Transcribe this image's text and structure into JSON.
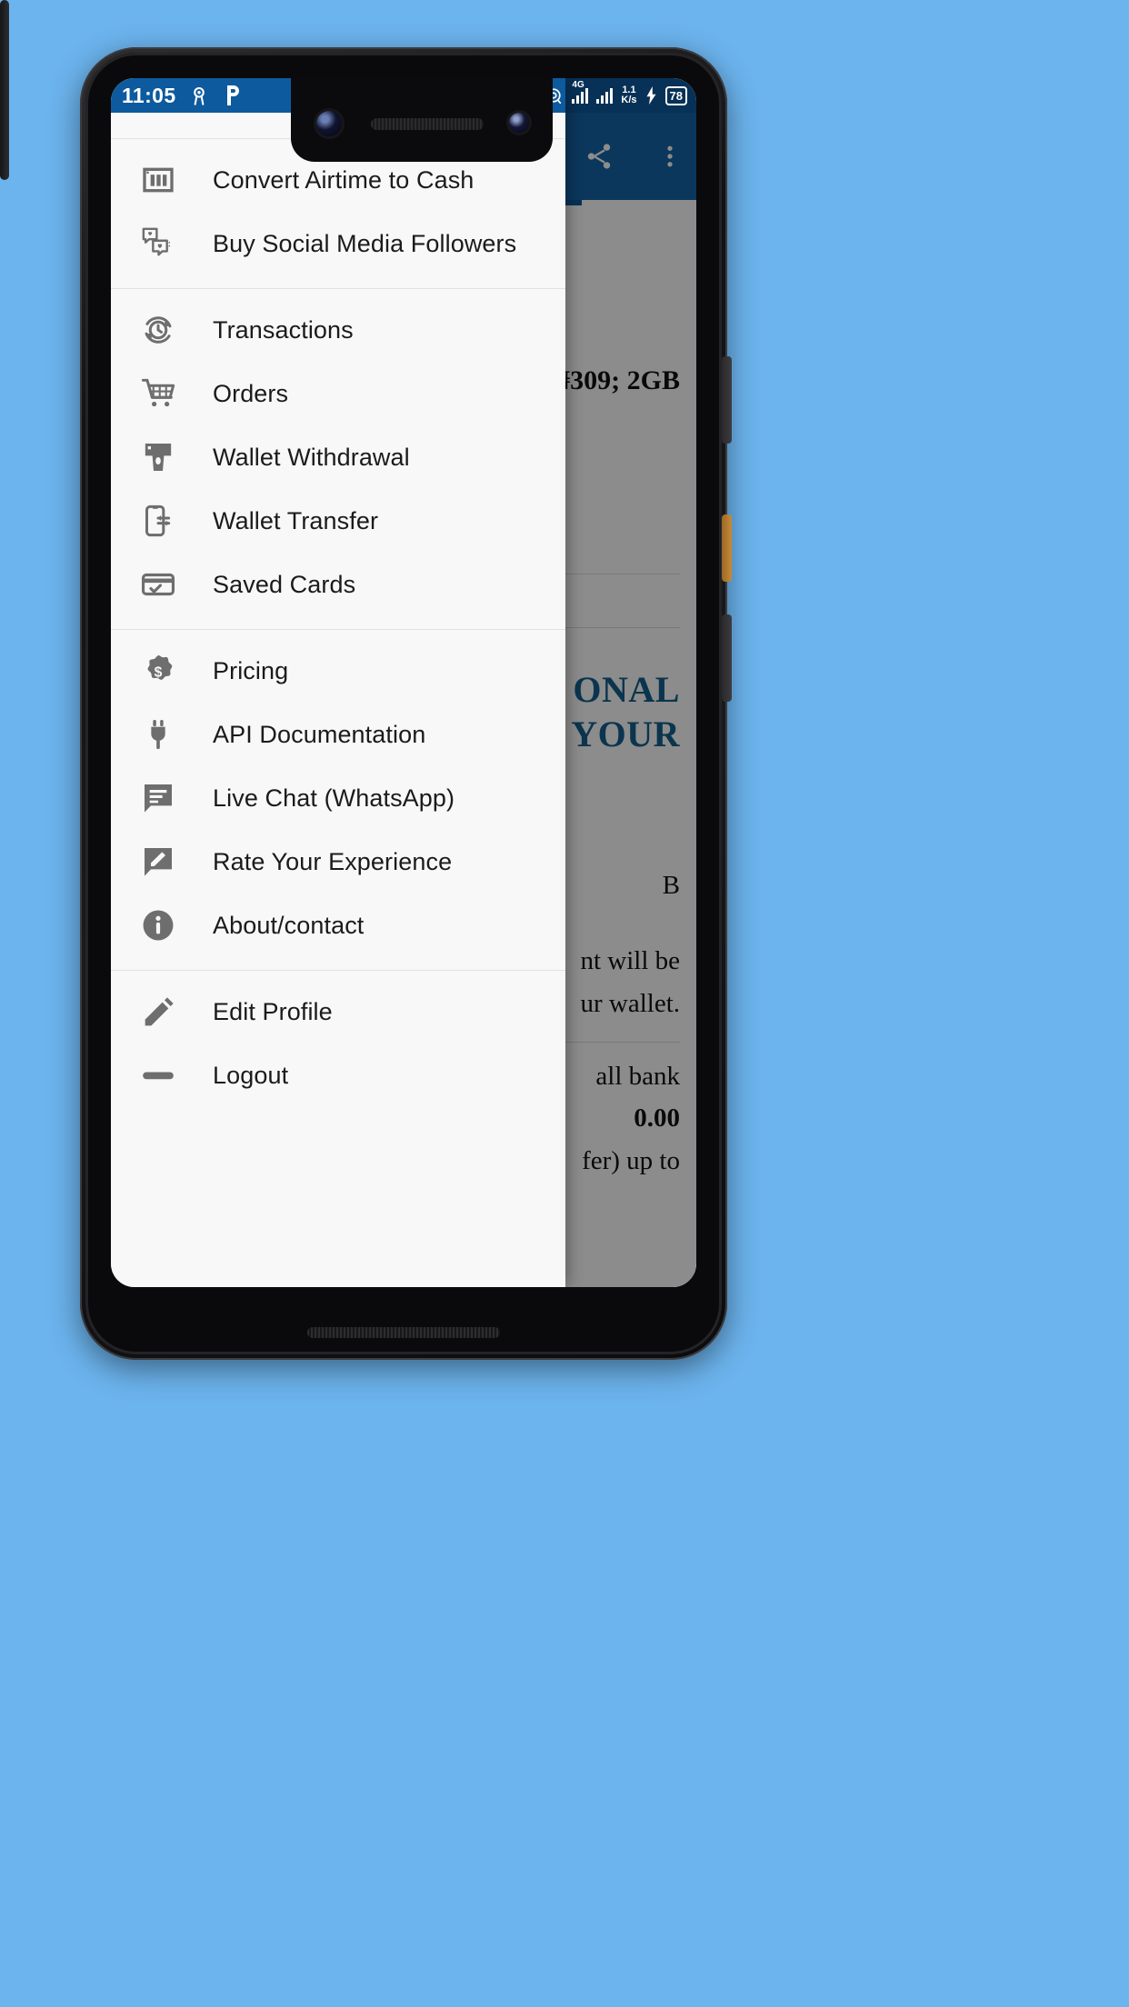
{
  "status_bar": {
    "time": "11:05",
    "left_icons": [
      "location-icon",
      "p-app-icon"
    ],
    "right_icons": [
      "bluetooth-icon",
      "location-icon",
      "signal-4g-icon",
      "signal-bars-icon",
      "battery-icon"
    ],
    "network_speed": "1.1",
    "network_speed_unit": "K/s",
    "network_type": "4G",
    "battery_percent": "78",
    "charging": true
  },
  "app_bar": {
    "share_label": "share-icon",
    "overflow_label": "more-vert-icon"
  },
  "drawer": {
    "groups": [
      {
        "items": [
          {
            "icon": "airtime-card-icon",
            "label": "Convert Airtime to Cash"
          },
          {
            "icon": "social-chat-heart-icon",
            "label": "Buy Social Media Followers"
          }
        ]
      },
      {
        "items": [
          {
            "icon": "history-clock-icon",
            "label": "Transactions"
          },
          {
            "icon": "shopping-cart-icon",
            "label": "Orders"
          },
          {
            "icon": "atm-withdraw-icon",
            "label": "Wallet Withdrawal"
          },
          {
            "icon": "phone-transfer-icon",
            "label": "Wallet Transfer"
          },
          {
            "icon": "saved-card-icon",
            "label": "Saved Cards"
          }
        ]
      },
      {
        "items": [
          {
            "icon": "dollar-badge-icon",
            "label": "Pricing"
          },
          {
            "icon": "plug-icon",
            "label": "API Documentation"
          },
          {
            "icon": "chat-lines-icon",
            "label": "Live Chat (WhatsApp)"
          },
          {
            "icon": "chat-edit-icon",
            "label": "Rate Your Experience"
          },
          {
            "icon": "info-circle-icon",
            "label": "About/contact"
          }
        ]
      },
      {
        "items": [
          {
            "icon": "pencil-icon",
            "label": "Edit Profile"
          },
          {
            "icon": "logout-icon",
            "label": "Logout"
          }
        ]
      }
    ]
  },
  "background_app": {
    "price_row": "₦309; 2GB",
    "promo_heading_line1": "ONAL",
    "promo_heading_line2": "YOUR",
    "detail_line_0": "B",
    "detail_line_1": "nt will be",
    "detail_line_2": "ur wallet.",
    "detail_line_3": "all bank",
    "detail_line_4": "0.00",
    "detail_line_5": "fer) up to"
  },
  "colors": {
    "accent_blue": "#0d5a9e",
    "promo_heading": "#15628f",
    "wallpaper": "#6cb4ee",
    "drawer_bg": "#f8f8f8",
    "icon_grey": "#6e6e6e"
  }
}
